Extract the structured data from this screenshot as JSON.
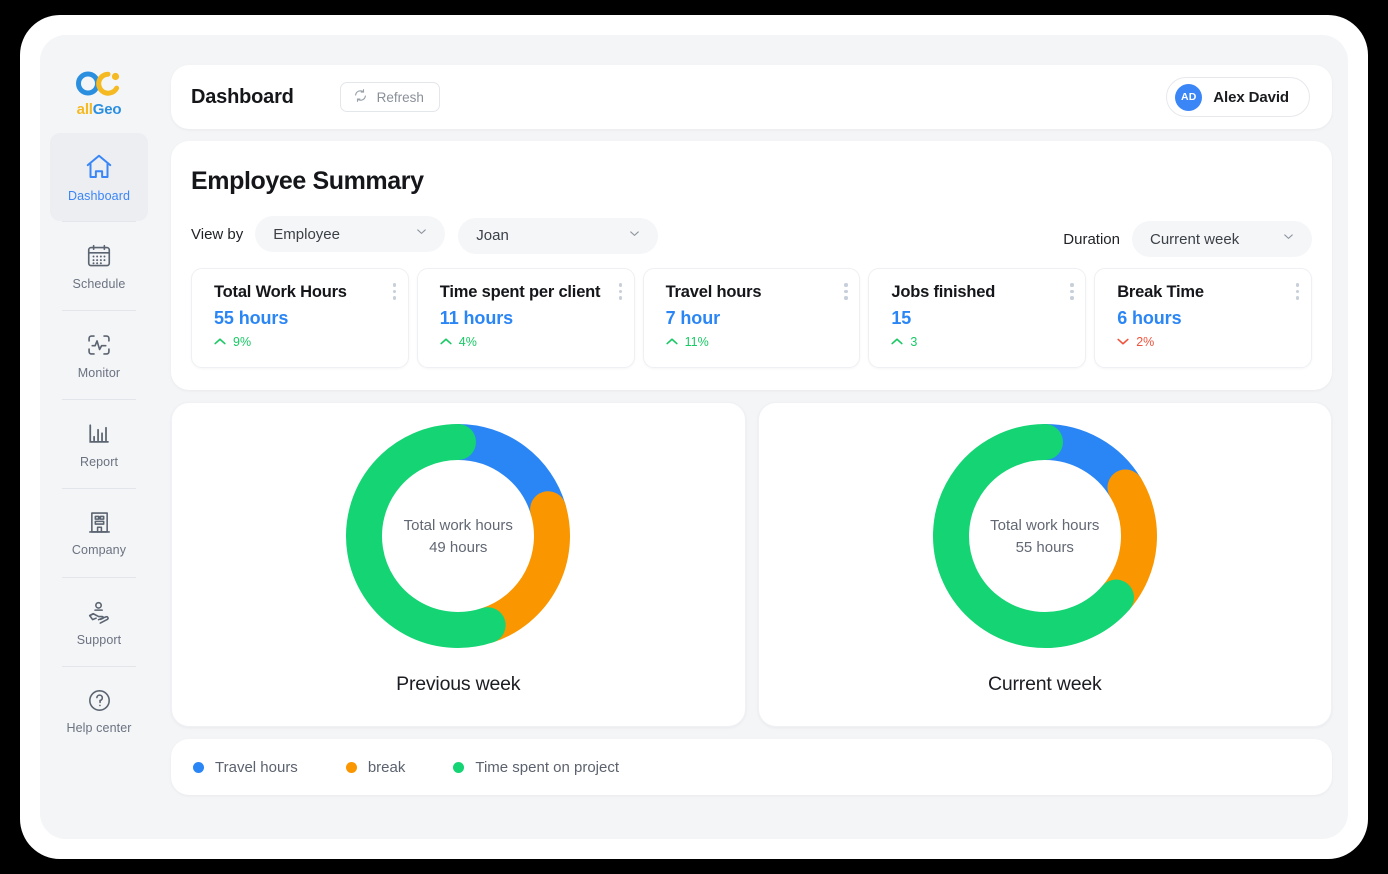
{
  "brand": {
    "name_part1": "all",
    "name_part2": "Geo",
    "blue": "#2b8fe0",
    "yellow": "#f5b922"
  },
  "sidebar": {
    "items": [
      {
        "label": "Dashboard",
        "icon": "home-icon",
        "active": true
      },
      {
        "label": "Schedule",
        "icon": "calendar-icon",
        "active": false
      },
      {
        "label": "Monitor",
        "icon": "activity-monitor-icon",
        "active": false
      },
      {
        "label": "Report",
        "icon": "bar-chart-icon",
        "active": false
      },
      {
        "label": "Company",
        "icon": "building-icon",
        "active": false
      },
      {
        "label": "Support",
        "icon": "hand-support-icon",
        "active": false
      },
      {
        "label": "Help center",
        "icon": "question-circle-icon",
        "active": false
      }
    ]
  },
  "header": {
    "title": "Dashboard",
    "refresh_label": "Refresh",
    "user_initials": "AD",
    "user_name": "Alex David"
  },
  "summary": {
    "title": "Employee Summary",
    "view_by_label": "View by",
    "view_by_value": "Employee",
    "employee_value": "Joan",
    "duration_label": "Duration",
    "duration_value": "Current week"
  },
  "stats": [
    {
      "title": "Total Work Hours",
      "value": "55 hours",
      "delta": "9%",
      "direction": "up"
    },
    {
      "title": "Time spent per client",
      "value": "11 hours",
      "delta": "4%",
      "direction": "up"
    },
    {
      "title": "Travel hours",
      "value": "7 hour",
      "delta": "11%",
      "direction": "up"
    },
    {
      "title": "Jobs finished",
      "value": "15",
      "delta": "3",
      "direction": "up"
    },
    {
      "title": "Break Time",
      "value": "6 hours",
      "delta": "2%",
      "direction": "down"
    }
  ],
  "legend": [
    {
      "label": "Travel hours",
      "color": "#2b86f5"
    },
    {
      "label": "break",
      "color": "#fa9600"
    },
    {
      "label": "Time spent on project",
      "color": "#14d473"
    }
  ],
  "chart_data": [
    {
      "type": "pie",
      "title": "Previous week",
      "center_label": "Total work hours",
      "center_value": "49 hours",
      "total_hours": 49,
      "categories": [
        "Travel hours",
        "break",
        "Time spent on project"
      ],
      "values": [
        10,
        12,
        27
      ],
      "percents": [
        20,
        24,
        56
      ],
      "colors": [
        "#2b86f5",
        "#fa9600",
        "#14d473"
      ],
      "legend_position": "bottom",
      "donut": true
    },
    {
      "type": "pie",
      "title": "Current week",
      "center_label": "Total work hours",
      "center_value": "55 hours",
      "total_hours": 55,
      "categories": [
        "Travel hours",
        "break",
        "Time spent on project"
      ],
      "values": [
        9,
        11,
        35
      ],
      "percents": [
        17,
        20,
        63
      ],
      "colors": [
        "#2b86f5",
        "#fa9600",
        "#14d473"
      ],
      "legend_position": "bottom",
      "donut": true
    }
  ]
}
